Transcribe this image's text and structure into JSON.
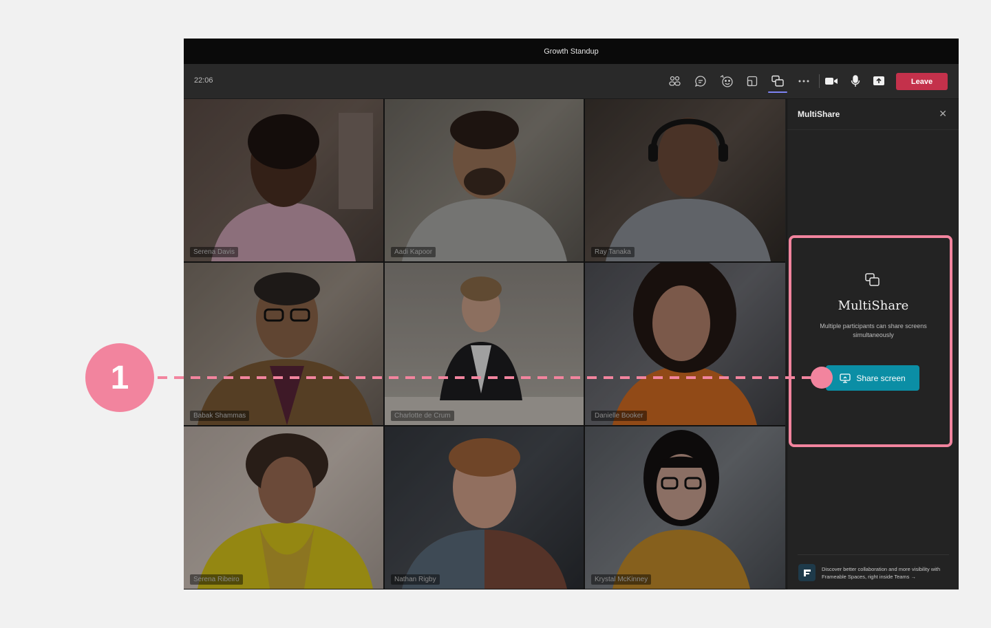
{
  "window": {
    "title": "Growth Standup"
  },
  "toolbar": {
    "time": "22:06",
    "buttons": [
      {
        "name": "people-icon"
      },
      {
        "name": "chat-icon"
      },
      {
        "name": "reactions-icon"
      },
      {
        "name": "rooms-icon"
      },
      {
        "name": "multishare-icon"
      },
      {
        "name": "more-icon"
      },
      {
        "name": "camera-icon"
      },
      {
        "name": "mic-icon"
      },
      {
        "name": "share-tray-icon"
      }
    ],
    "leave_label": "Leave"
  },
  "participants": [
    {
      "name": "Serena Davis"
    },
    {
      "name": "Aadi Kapoor"
    },
    {
      "name": "Ray Tanaka"
    },
    {
      "name": "Babak Shammas"
    },
    {
      "name": "Charlotte de Crum"
    },
    {
      "name": "Danielle Booker"
    },
    {
      "name": "Serena Ribeiro"
    },
    {
      "name": "Nathan Rigby"
    },
    {
      "name": "Krystal McKinney"
    }
  ],
  "panel": {
    "title": "MultiShare",
    "close_icon": "close-icon",
    "heading": "MultiShare",
    "description": "Multiple participants can share screens simultaneously",
    "share_button_label": "Share screen",
    "promo_text": "Discover better collaboration and more visibility with Frameable Spaces, right inside Teams",
    "promo_arrow": "→"
  },
  "annotation": {
    "number": "1",
    "color": "#f2849e"
  },
  "colors": {
    "leave": "#c4314b",
    "share_button": "#0b8ea5",
    "accent": "#7f85f5"
  }
}
